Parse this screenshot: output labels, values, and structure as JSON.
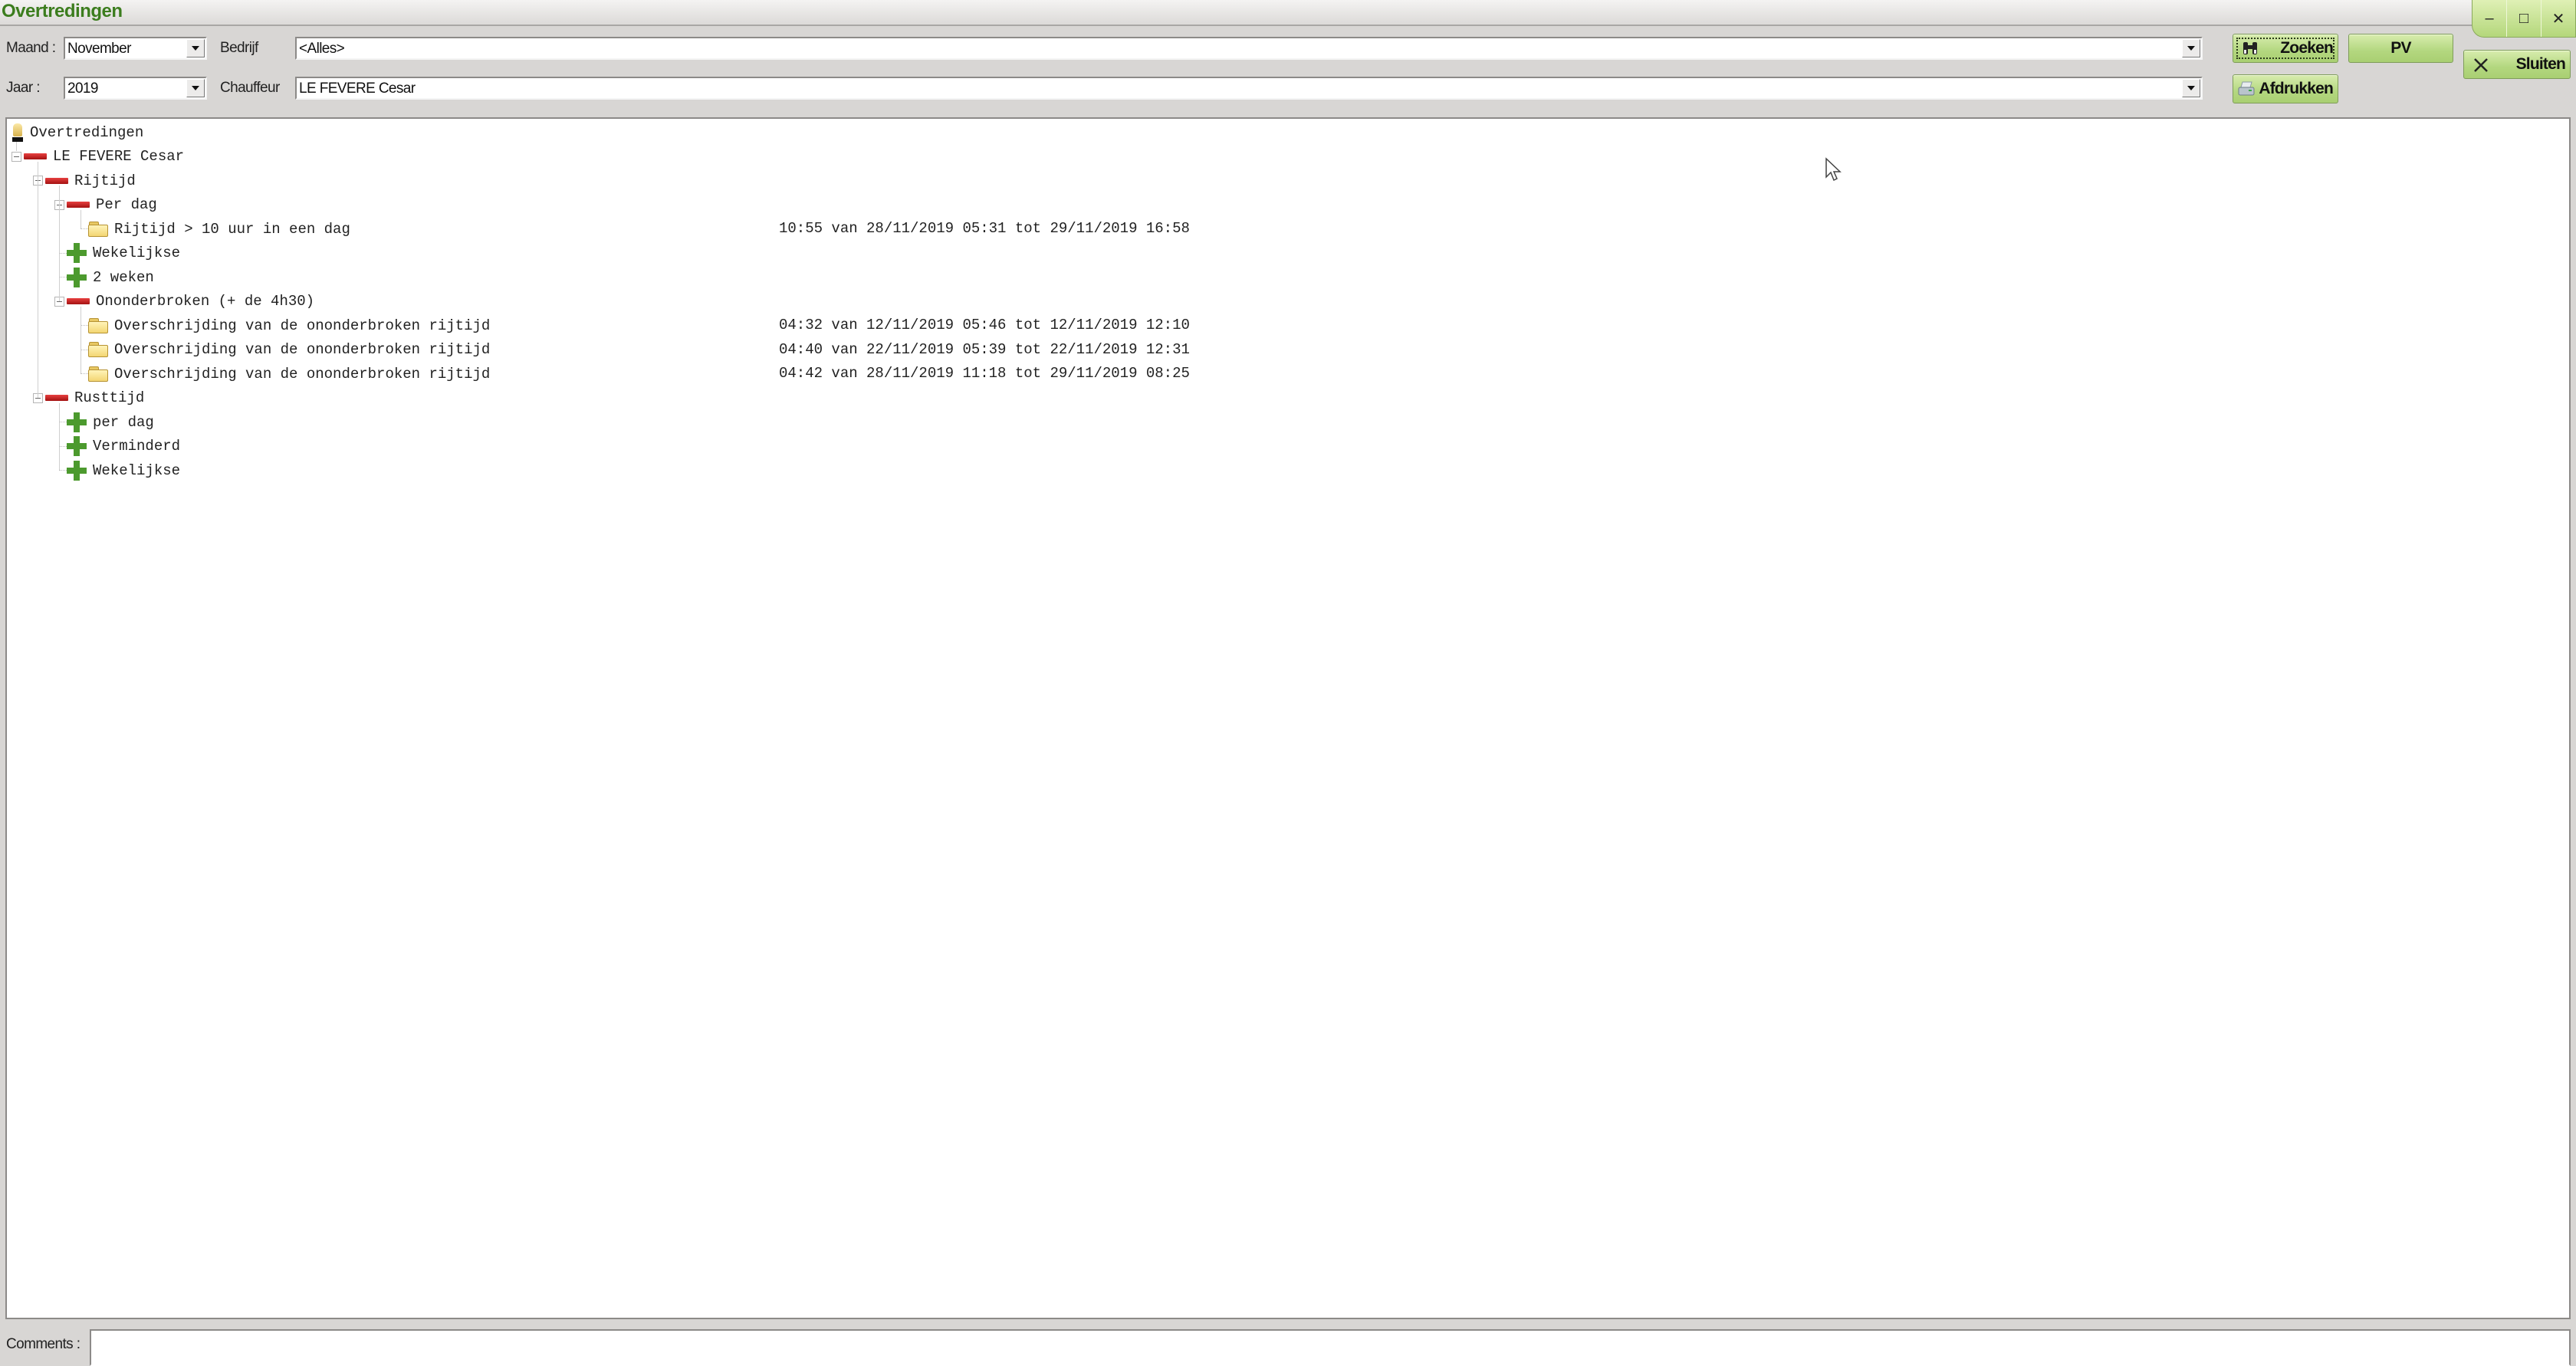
{
  "window": {
    "title": "Overtredingen",
    "controls": [
      {
        "name": "minimize",
        "glyph": "–"
      },
      {
        "name": "maximize",
        "glyph": "□"
      },
      {
        "name": "close",
        "glyph": "✕"
      }
    ]
  },
  "filters": {
    "maand_label": "Maand :",
    "maand_value": "November",
    "jaar_label": "Jaar :",
    "jaar_value": "2019",
    "bedrijf_label": "Bedrijf",
    "bedrijf_value": "<Alles>",
    "chauffeur_label": "Chauffeur",
    "chauffeur_value": "LE FEVERE Cesar"
  },
  "buttons": {
    "zoeken": {
      "label": "Zoeken",
      "icon": "binoculars-icon"
    },
    "afdrukken": {
      "label": "Afdrukken",
      "icon": "printer-icon"
    },
    "pv": {
      "label": "PV"
    },
    "sluiten": {
      "label": "Sluiten",
      "icon": "close-x-icon"
    }
  },
  "tree": {
    "root": "Overtredingen",
    "nodes": [
      {
        "label": "LE FEVERE Cesar",
        "level": 1,
        "icon": "minus-bar",
        "expanded": true
      },
      {
        "label": "Rijtijd",
        "level": 2,
        "icon": "minus-bar",
        "expanded": true
      },
      {
        "label": "Per dag",
        "level": 3,
        "icon": "minus-bar",
        "expanded": true
      },
      {
        "label": "Rijtijd > 10 uur in een dag",
        "level": 4,
        "icon": "folder",
        "detail": "10:55 van 28/11/2019 05:31 tot 29/11/2019 16:58"
      },
      {
        "label": "Wekelijkse",
        "level": 3,
        "icon": "plus"
      },
      {
        "label": "2 weken",
        "level": 3,
        "icon": "plus"
      },
      {
        "label": "Ononderbroken (+ de 4h30)",
        "level": 3,
        "icon": "minus-bar",
        "expanded": true
      },
      {
        "label": "Overschrijding van de ononderbroken rijtijd",
        "level": 4,
        "icon": "folder",
        "detail": "04:32 van 12/11/2019 05:46 tot 12/11/2019 12:10"
      },
      {
        "label": "Overschrijding van de ononderbroken rijtijd",
        "level": 4,
        "icon": "folder",
        "detail": "04:40 van 22/11/2019 05:39 tot 22/11/2019 12:31"
      },
      {
        "label": "Overschrijding van de ononderbroken rijtijd",
        "level": 4,
        "icon": "folder",
        "detail": "04:42 van 28/11/2019 11:18 tot 29/11/2019 08:25"
      },
      {
        "label": "Rusttijd",
        "level": 2,
        "icon": "minus-bar",
        "expanded": true
      },
      {
        "label": "per dag",
        "level": 3,
        "icon": "plus"
      },
      {
        "label": "Verminderd",
        "level": 3,
        "icon": "plus"
      },
      {
        "label": "Wekelijkse",
        "level": 3,
        "icon": "plus"
      }
    ]
  },
  "comments": {
    "label": "Comments :",
    "value": ""
  },
  "colors": {
    "title": "#3c7d1e",
    "button": "#b3d77f",
    "minus_bar": "#c41e1e",
    "plus": "#4c9a2e",
    "folder": "#f3d673"
  }
}
